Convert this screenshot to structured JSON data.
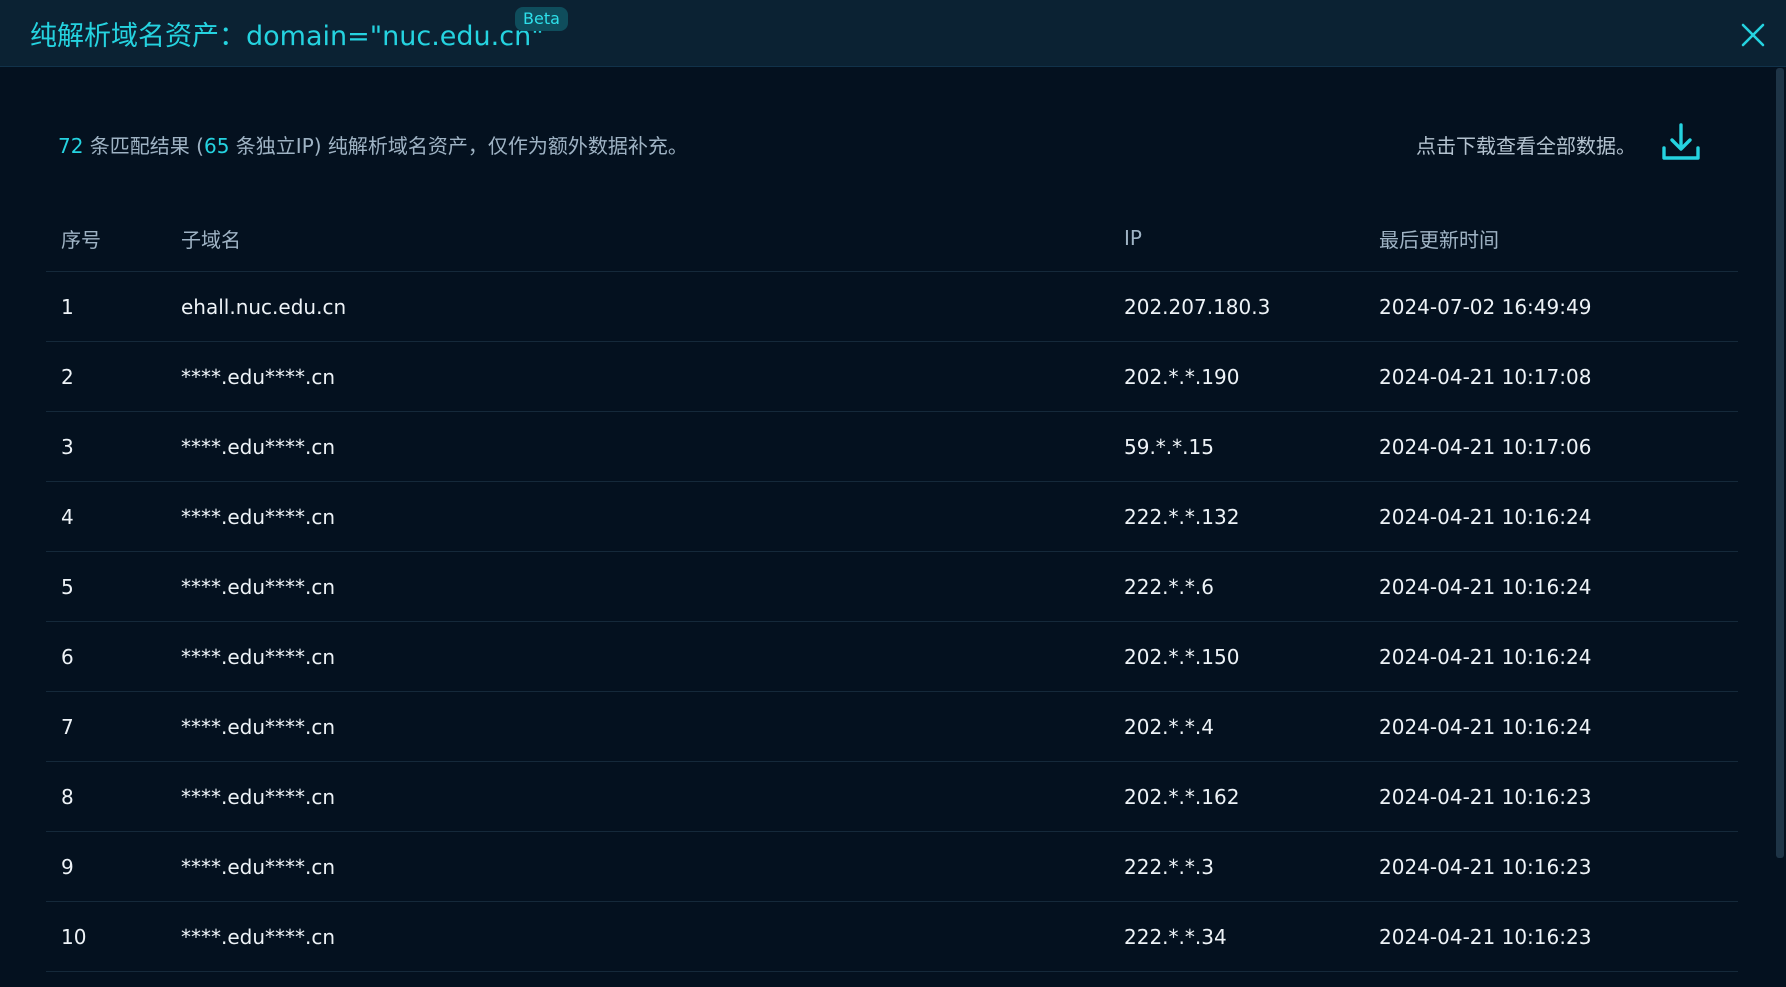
{
  "header": {
    "title": "纯解析域名资产：domain=\"nuc.edu.cn\"",
    "badge": "Beta"
  },
  "summary": {
    "match_count": "72",
    "text1": " 条匹配结果 (",
    "ip_count": "65",
    "text2": " 条独立IP) 纯解析域名资产，仅作为额外数据补充。"
  },
  "download": {
    "text": "点击下载查看全部数据。",
    "icon": "download-icon"
  },
  "table": {
    "columns": [
      "序号",
      "子域名",
      "IP",
      "最后更新时间"
    ],
    "rows": [
      [
        "1",
        "ehall.nuc.edu.cn",
        "202.207.180.3",
        "2024-07-02 16:49:49"
      ],
      [
        "2",
        "****.edu****.cn",
        "202.*.*.190",
        "2024-04-21 10:17:08"
      ],
      [
        "3",
        "****.edu****.cn",
        "59.*.*.15",
        "2024-04-21 10:17:06"
      ],
      [
        "4",
        "****.edu****.cn",
        "222.*.*.132",
        "2024-04-21 10:16:24"
      ],
      [
        "5",
        "****.edu****.cn",
        "222.*.*.6",
        "2024-04-21 10:16:24"
      ],
      [
        "6",
        "****.edu****.cn",
        "202.*.*.150",
        "2024-04-21 10:16:24"
      ],
      [
        "7",
        "****.edu****.cn",
        "202.*.*.4",
        "2024-04-21 10:16:24"
      ],
      [
        "8",
        "****.edu****.cn",
        "202.*.*.162",
        "2024-04-21 10:16:23"
      ],
      [
        "9",
        "****.edu****.cn",
        "222.*.*.3",
        "2024-04-21 10:16:23"
      ],
      [
        "10",
        "****.edu****.cn",
        "222.*.*.34",
        "2024-04-21 10:16:23"
      ]
    ]
  },
  "colors": {
    "accent": "#25d3e0",
    "background": "#04111f",
    "header_bg": "#0b2233"
  }
}
